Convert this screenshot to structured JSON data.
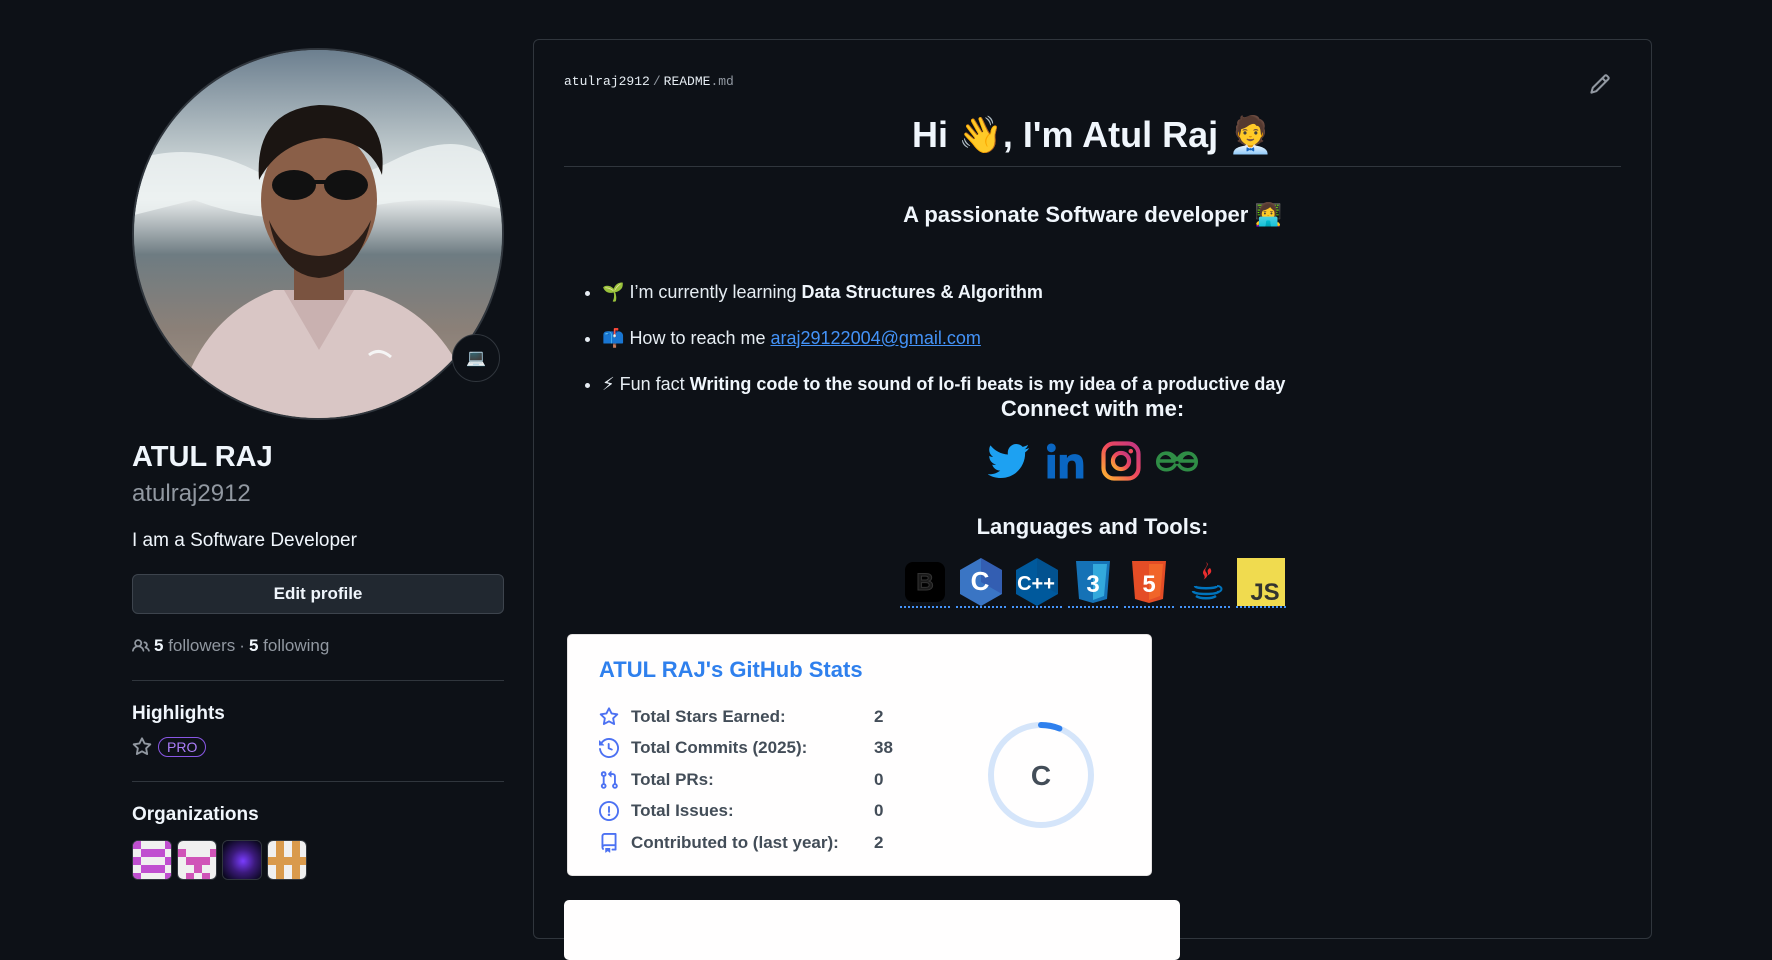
{
  "profile": {
    "full_name": "ATUL RAJ",
    "username": "atulraj2912",
    "bio": "I am a Software Developer",
    "status_emoji": "💻",
    "edit_profile_label": "Edit profile",
    "followers_count": "5",
    "followers_label": "followers",
    "separator": "·",
    "following_count": "5",
    "following_label": "following"
  },
  "highlights": {
    "title": "Highlights",
    "badge": "PRO"
  },
  "organizations": {
    "title": "Organizations"
  },
  "readme": {
    "path_owner": "atulraj2912",
    "path_sep": "/",
    "path_file": "README",
    "path_ext": ".md",
    "heading": "Hi 👋, I'm Atul Raj 🧑‍💼",
    "subheading": "A passionate Software developer 👩‍💻",
    "items": [
      {
        "emoji": "🌱",
        "prefix": "I’m currently learning ",
        "bold": "Data Structures & Algorithm"
      },
      {
        "emoji": "📫",
        "prefix": "How to reach me ",
        "link": "araj29122004@gmail.com"
      },
      {
        "emoji": "⚡",
        "prefix": "Fun fact ",
        "bold": "Writing code to the sound of lo-fi beats is my idea of a productive day"
      }
    ],
    "connect_title": "Connect with me:",
    "tools_title": "Languages and Tools:",
    "tool_letters": {
      "bootstrap": "B",
      "c": "C",
      "cpp": "C++",
      "css": "3",
      "html": "5",
      "javascript": "JS"
    }
  },
  "stats": {
    "title": "ATUL RAJ's GitHub Stats",
    "rows": [
      {
        "icon": "star-icon",
        "label": "Total Stars Earned:",
        "value": "2"
      },
      {
        "icon": "history-icon",
        "label": "Total Commits (2025):",
        "value": "38"
      },
      {
        "icon": "pull-request-icon",
        "label": "Total PRs:",
        "value": "0"
      },
      {
        "icon": "issue-icon",
        "label": "Total Issues:",
        "value": "0"
      },
      {
        "icon": "repo-icon",
        "label": "Contributed to (last year):",
        "value": "2"
      }
    ],
    "rank": "C",
    "rank_progress": 0.06
  },
  "colors": {
    "background": "#0d1117",
    "border": "#30363d",
    "link": "#4493f8",
    "pro_purple": "#ab7df8",
    "stats_title": "#2f80ed",
    "stats_icon": "#4c71f2"
  }
}
